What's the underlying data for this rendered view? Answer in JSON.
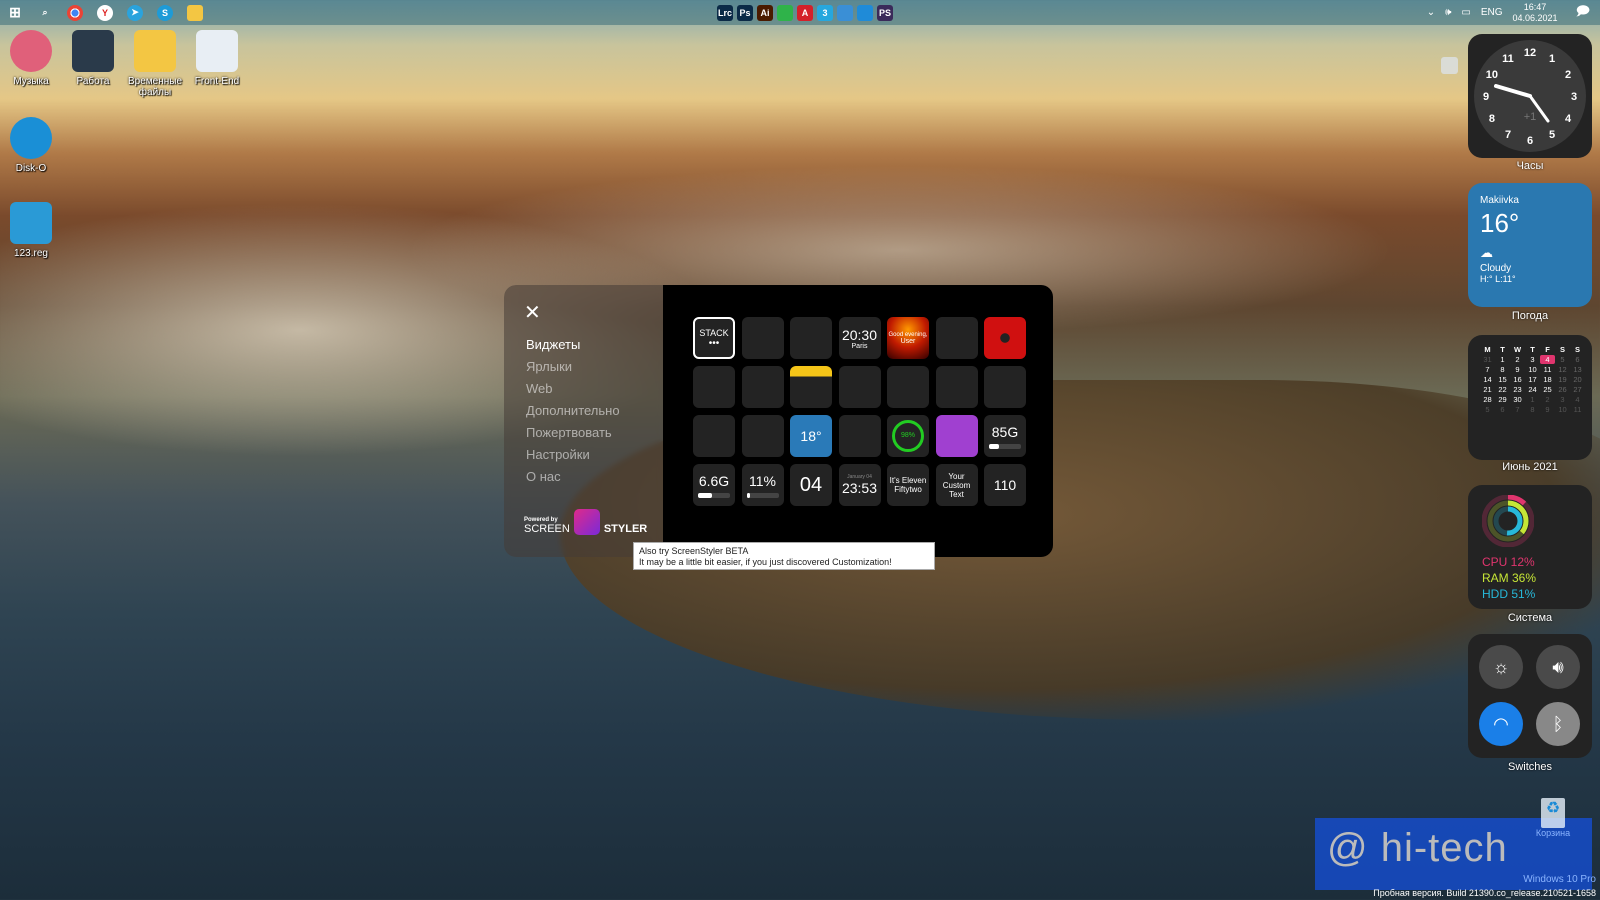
{
  "taskbar": {
    "left_icons": [
      "windows-start",
      "search",
      "chrome",
      "yandex",
      "telegram",
      "skype",
      "file-explorer"
    ],
    "pinned": [
      {
        "label": "Lrc",
        "color": "#0b2a47"
      },
      {
        "label": "Ps",
        "color": "#0b2a47"
      },
      {
        "label": "Ai",
        "color": "#4a1a00"
      },
      {
        "label": "",
        "color": "#2fb34a"
      },
      {
        "label": "A",
        "color": "#d4202a"
      },
      {
        "label": "3",
        "color": "#26a7de"
      },
      {
        "label": "",
        "color": "#3a8fd6"
      },
      {
        "label": "",
        "color": "#1f8bd8"
      },
      {
        "label": "PS",
        "color": "#3a2a5a"
      }
    ],
    "lang": "ENG",
    "time": "16:47",
    "date": "04.06.2021"
  },
  "desktop_icons": [
    {
      "label": "Музыка",
      "color": "#e0607a"
    },
    {
      "label": "Работа",
      "color": "#2a3a4a"
    },
    {
      "label": "Временные файлы",
      "color": "#f3c643"
    },
    {
      "label": "Front-End",
      "color": "#e8eef4"
    },
    {
      "label": "Disk-O",
      "color": "#1a8fd6"
    },
    {
      "label": "123.reg",
      "color": "#2a9ad6"
    }
  ],
  "clock_widget": {
    "numbers": [
      "12",
      "1",
      "2",
      "3",
      "4",
      "5",
      "6",
      "7",
      "8",
      "9",
      "10",
      "11"
    ],
    "offset": "+1",
    "label": "Часы"
  },
  "weather": {
    "city": "Makiivka",
    "temp": "16°",
    "condition": "Cloudy",
    "hilo": "H:° L:11°",
    "label": "Погода",
    "color": "#2a78b0"
  },
  "calendar": {
    "weekdays": [
      "M",
      "T",
      "W",
      "T",
      "F",
      "S",
      "S"
    ],
    "days": [
      "31",
      "1",
      "2",
      "3",
      "4",
      "5",
      "6",
      "7",
      "8",
      "9",
      "10",
      "11",
      "12",
      "13",
      "14",
      "15",
      "16",
      "17",
      "18",
      "19",
      "20",
      "21",
      "22",
      "23",
      "24",
      "25",
      "26",
      "27",
      "28",
      "29",
      "30",
      "1",
      "2",
      "3",
      "4",
      "5",
      "6",
      "7",
      "8",
      "9",
      "10",
      "11"
    ],
    "today": "4",
    "label": "Июнь 2021"
  },
  "system": {
    "cpu": "CPU 12%",
    "ram": "RAM 36%",
    "hdd": "HDD 51%",
    "cpu_pct": 12,
    "ram_pct": 36,
    "hdd_pct": 51,
    "label": "Система",
    "colors": {
      "cpu": "#e0356e",
      "ram": "#c6e636",
      "hdd": "#27b8d9"
    }
  },
  "switches": {
    "label": "Switches",
    "items": [
      "brightness",
      "volume",
      "wifi",
      "bluetooth"
    ],
    "wifi_on": true
  },
  "recycle_bin": {
    "label": "Корзина"
  },
  "watermark": {
    "text": "@ hi-tech"
  },
  "os": {
    "edition": "Windows 10 Pro",
    "build": "Пробная версия. Build 21390.co_release.210521-1658"
  },
  "panel": {
    "nav": [
      "Виджеты",
      "Ярлыки",
      "Web",
      "Дополнительно",
      "Пожертвовать",
      "Настройки",
      "О нас"
    ],
    "powered_by": "Powered by",
    "brand_left": "SCREEN",
    "brand_right": "STYLER",
    "tiles": [
      {
        "name": "stack",
        "main": "STACK",
        "sub": "•••"
      },
      {
        "name": "calendar",
        "main": "",
        "sub": ""
      },
      {
        "name": "analog-clock",
        "main": "",
        "sub": ""
      },
      {
        "name": "world-clock",
        "main": "20:30",
        "sub": "Paris"
      },
      {
        "name": "greeting",
        "main": "Good evening,",
        "sub": "User"
      },
      {
        "name": "app-shortcuts",
        "main": "",
        "sub": ""
      },
      {
        "name": "record",
        "main": "",
        "sub": ""
      },
      {
        "name": "moon",
        "main": "",
        "sub": ""
      },
      {
        "name": "music",
        "main": "",
        "sub": ""
      },
      {
        "name": "notes",
        "main": "",
        "sub": ""
      },
      {
        "name": "quote",
        "main": "",
        "sub": ""
      },
      {
        "name": "news",
        "main": "",
        "sub": ""
      },
      {
        "name": "photos",
        "main": "",
        "sub": ""
      },
      {
        "name": "system",
        "main": "",
        "sub": ""
      },
      {
        "name": "timers",
        "main": "",
        "sub": ""
      },
      {
        "name": "sliders",
        "main": "",
        "sub": ""
      },
      {
        "name": "weather",
        "main": "18°",
        "sub": ""
      },
      {
        "name": "world-clocks",
        "main": "",
        "sub": ""
      },
      {
        "name": "battery-ring",
        "main": "98%",
        "sub": ""
      },
      {
        "name": "game",
        "main": "",
        "sub": ""
      },
      {
        "name": "disk-free",
        "main": "85G",
        "sub": ""
      },
      {
        "name": "ram-used",
        "main": "6.6G",
        "sub": ""
      },
      {
        "name": "cpu-usage",
        "main": "11%",
        "sub": ""
      },
      {
        "name": "day",
        "main": "04",
        "sub": ""
      },
      {
        "name": "date-time",
        "main": "23:53",
        "sub": "January 04"
      },
      {
        "name": "text-time",
        "main": "It's Eleven Fiftytwo",
        "sub": ""
      },
      {
        "name": "custom-text",
        "main": "Your Custom Text",
        "sub": ""
      },
      {
        "name": "counter",
        "main": "110",
        "sub": ""
      }
    ]
  },
  "tooltip": {
    "line1": "Also try ScreenStyler BETA",
    "line2": "It may be a little bit easier, if you just discovered Customization!"
  }
}
